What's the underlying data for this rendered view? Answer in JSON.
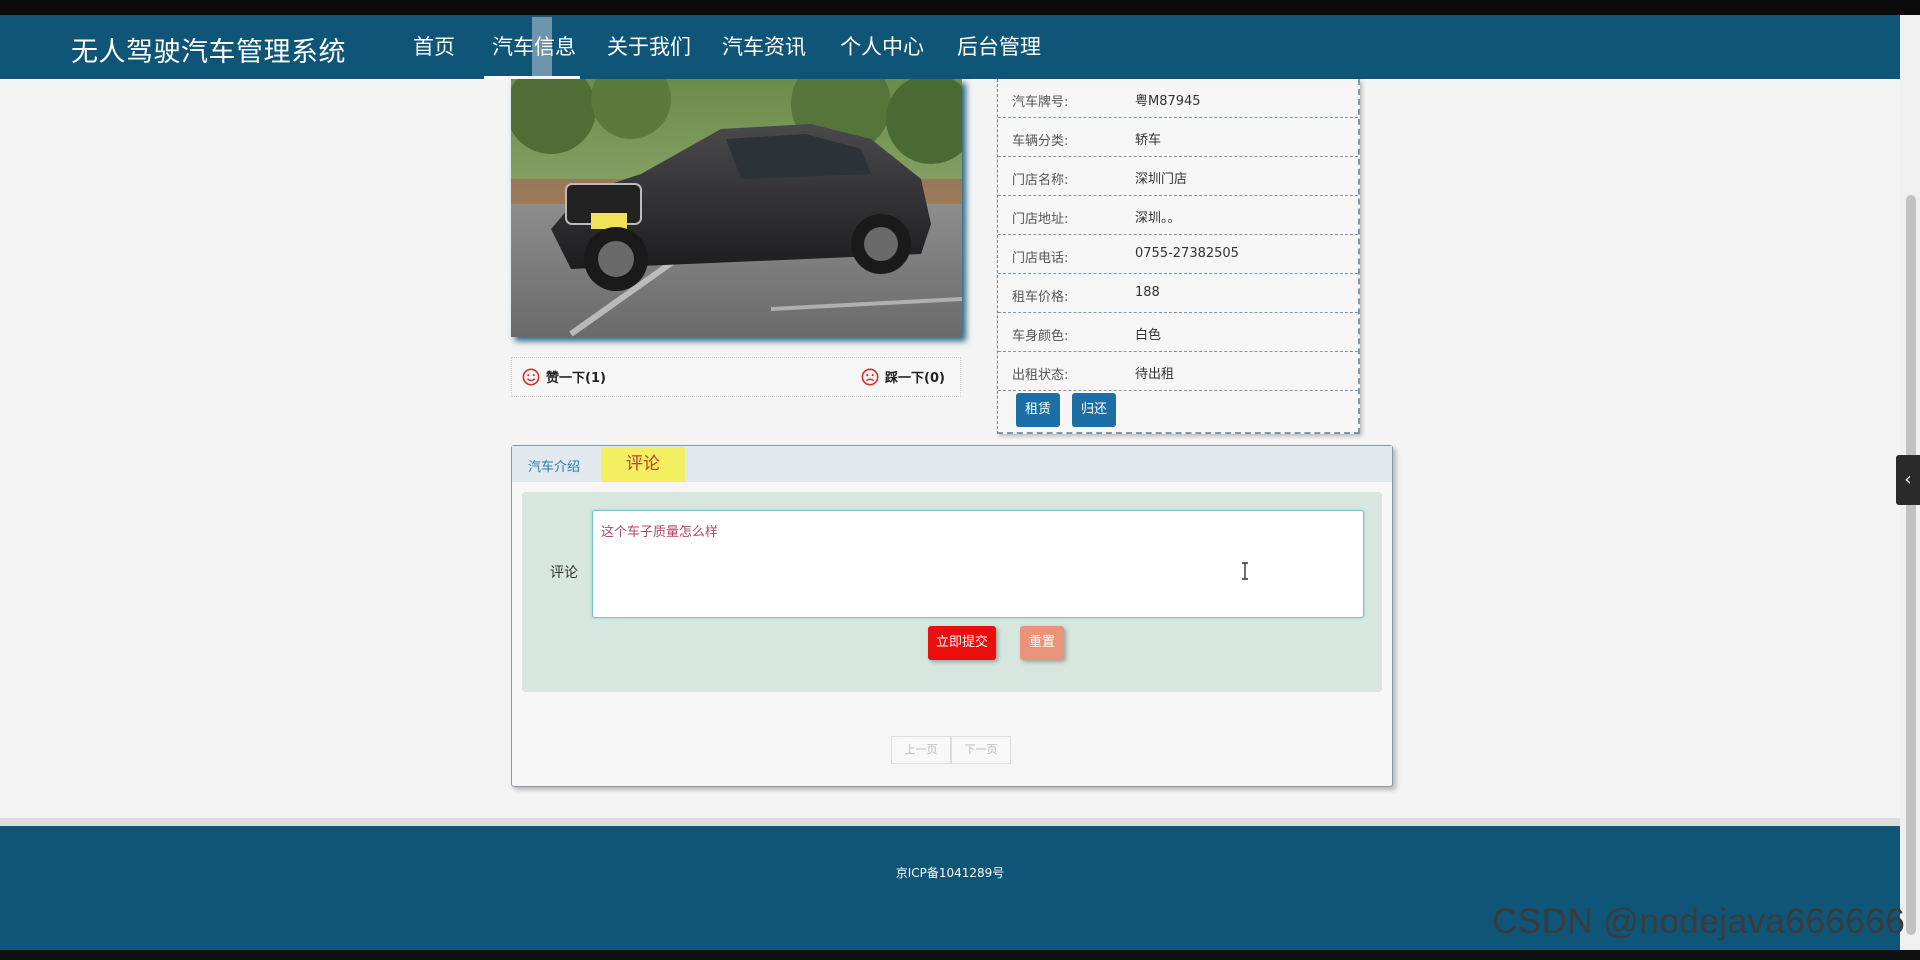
{
  "nav": {
    "brand": "无人驾驶汽车管理系统",
    "items": [
      {
        "label": "首页"
      },
      {
        "label": "汽车信息"
      },
      {
        "label": "关于我们"
      },
      {
        "label": "汽车资讯"
      },
      {
        "label": "个人中心"
      },
      {
        "label": "后台管理"
      }
    ]
  },
  "votes": {
    "like_label": "赞一下(1)",
    "dislike_label": "踩一下(0)"
  },
  "car_info": {
    "rows": [
      {
        "label": "汽车牌号:",
        "value": "粤M87945"
      },
      {
        "label": "车辆分类:",
        "value": "轿车"
      },
      {
        "label": "门店名称:",
        "value": "深圳门店"
      },
      {
        "label": "门店地址:",
        "value": "深圳。。"
      },
      {
        "label": "门店电话:",
        "value": "0755-27382505"
      },
      {
        "label": "租车价格:",
        "value": "188"
      },
      {
        "label": "车身颜色:",
        "value": "白色"
      },
      {
        "label": "出租状态:",
        "value": "待出租"
      }
    ],
    "rent_label": "租赁",
    "return_label": "归还"
  },
  "tabs": {
    "intro_label": "汽车介绍",
    "comment_label": "评论"
  },
  "comment_form": {
    "label": "评论",
    "value": "这个车子质量怎么样",
    "submit_label": "立即提交",
    "reset_label": "重置"
  },
  "pager": {
    "prev_label": "上一页",
    "next_label": "下一页"
  },
  "footer": {
    "icp": "京ICP备1041289号"
  },
  "watermark": "CSDN @nodejava666666",
  "colors": {
    "primary": "#0e5577",
    "button_blue": "#1b6fa4",
    "submit_red": "#ec0d0d",
    "reset_salmon": "#e9937a",
    "tab_highlight": "#f2ef61"
  }
}
